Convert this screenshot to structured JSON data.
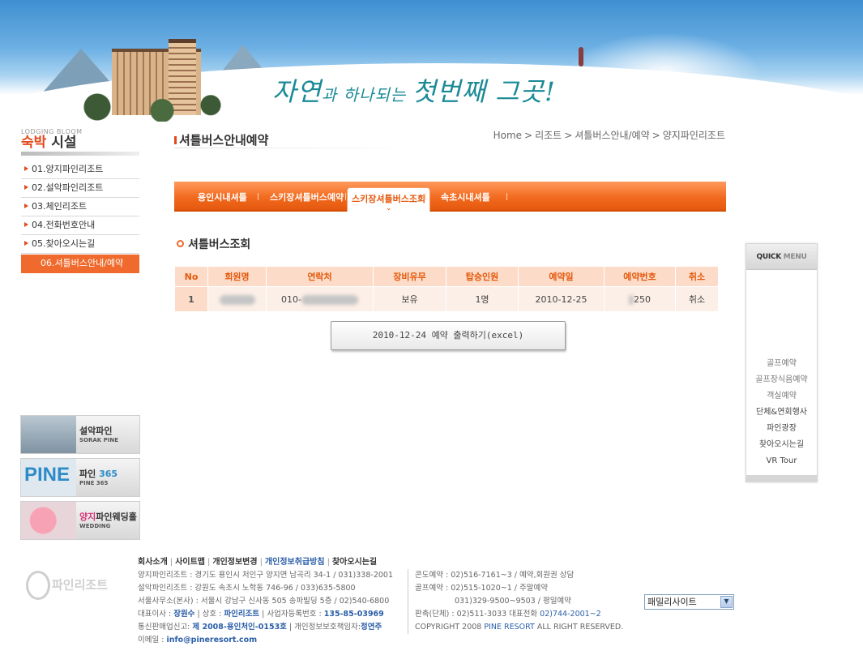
{
  "header": {
    "slogan_main": "자연",
    "slogan_mid": "과 하나되는 ",
    "slogan_end": "첫번째 그곳!"
  },
  "sidebar": {
    "title_en": "LODGING BLOOM",
    "title_red": "숙박",
    "title_rest": " 시설",
    "items": [
      {
        "label": "01.양지파인리조트"
      },
      {
        "label": "02.설악파인리조트"
      },
      {
        "label": "03.체인리조트"
      },
      {
        "label": "04.전화번호안내"
      },
      {
        "label": "05.찾아오시는길"
      },
      {
        "label": "06.셔틀버스안내/예약",
        "active": true
      }
    ],
    "banners": {
      "sorak": {
        "title": "설악파인",
        "sub": "SORAK PINE"
      },
      "pine": {
        "logo": "PINE",
        "title_pre": "파인 ",
        "title_num": "365",
        "sub": "PINE 365"
      },
      "wedding": {
        "title_pink": "양지",
        "title_rest": "파인웨딩홀",
        "sub": "WEDDING"
      }
    }
  },
  "page": {
    "title": "셔틀버스안내예약",
    "breadcrumb": [
      "Home",
      "리조트",
      "셔틀버스안내/예약",
      "양지파인리조트"
    ],
    "breadcrumb_sep": ">"
  },
  "tabs": [
    {
      "label": "용인시내셔틀"
    },
    {
      "label": "스키장셔틀버스예약"
    },
    {
      "label": "스키장셔틀버스조회",
      "active": true
    },
    {
      "label": "속초시내셔틀"
    }
  ],
  "section": {
    "title": "셔틀버스조회"
  },
  "table": {
    "headers": [
      "No",
      "회원명",
      "연락처",
      "장비유무",
      "탑승인원",
      "예약일",
      "예약번호",
      "취소"
    ],
    "rows": [
      {
        "no": "1",
        "name": "",
        "phone_prefix": "010-",
        "equipment": "보유",
        "passengers": "1명",
        "date": "2010-12-25",
        "reservation_no": "250",
        "cancel": "취소"
      }
    ]
  },
  "export_button": "2010-12-24 예약 출력하기(excel)",
  "quickmenu": {
    "title_dark": "QUICK",
    "title_grey": "MENU",
    "items": [
      "골프예약",
      "골프장식음예약",
      "객실예약",
      "단체&연회행사",
      "파인광장",
      "찾아오시는길",
      "VR Tour"
    ]
  },
  "footer": {
    "logo": "파인리조트",
    "links": [
      "회사소개",
      "사이트맵",
      "개인정보변경",
      "개인정보취급방침",
      "찾아오시는길"
    ],
    "left_lines": [
      "양지파인리조트 : 경기도 용인시 처인구 양지면 남곡리 34-1 / 031)338-2001",
      "설악파인리조트 : 강원도 속초시 노학동 746-96 / 033)635-5800",
      "서울사무소(본사) : 서울시 강남구 신사동 505 송파빌딩 5층 / 02)540-6800"
    ],
    "ceo_label": "대표이사 : ",
    "ceo": "장원수",
    "company_label": " | 상호 : ",
    "company": "파인리조트",
    "bizno_label": " | 사업자등록번호 : ",
    "bizno": "135-85-03969",
    "mail_order_label": "통신판매업신고: ",
    "mail_order": "제 2008-용인처인-0153호",
    "privacy_label": " | 개인정보보호책임자:",
    "privacy": "정연주",
    "email_label": "이메일 : ",
    "email": "info@pineresort.com",
    "right_lines": [
      {
        "label": "콘도예약 : ",
        "text": "02)516-7161~3 / 예약,회원권 상담"
      },
      {
        "label": "골프예약 : ",
        "text": "02)515-1020~1 / 주말예약"
      },
      {
        "label": "",
        "text": "031)329-9500~9503 / 평일예약"
      },
      {
        "label": "판촉(단체) : ",
        "text": "02)511-3033 대표전화 ",
        "extra": "02)744-2001~2"
      }
    ],
    "copyright_pre": "COPYRIGHT 2008 ",
    "copyright_brand": "PINE RESORT",
    "copyright_post": " ALL RIGHT RESERVED.",
    "family_site": "패밀리사이트"
  }
}
